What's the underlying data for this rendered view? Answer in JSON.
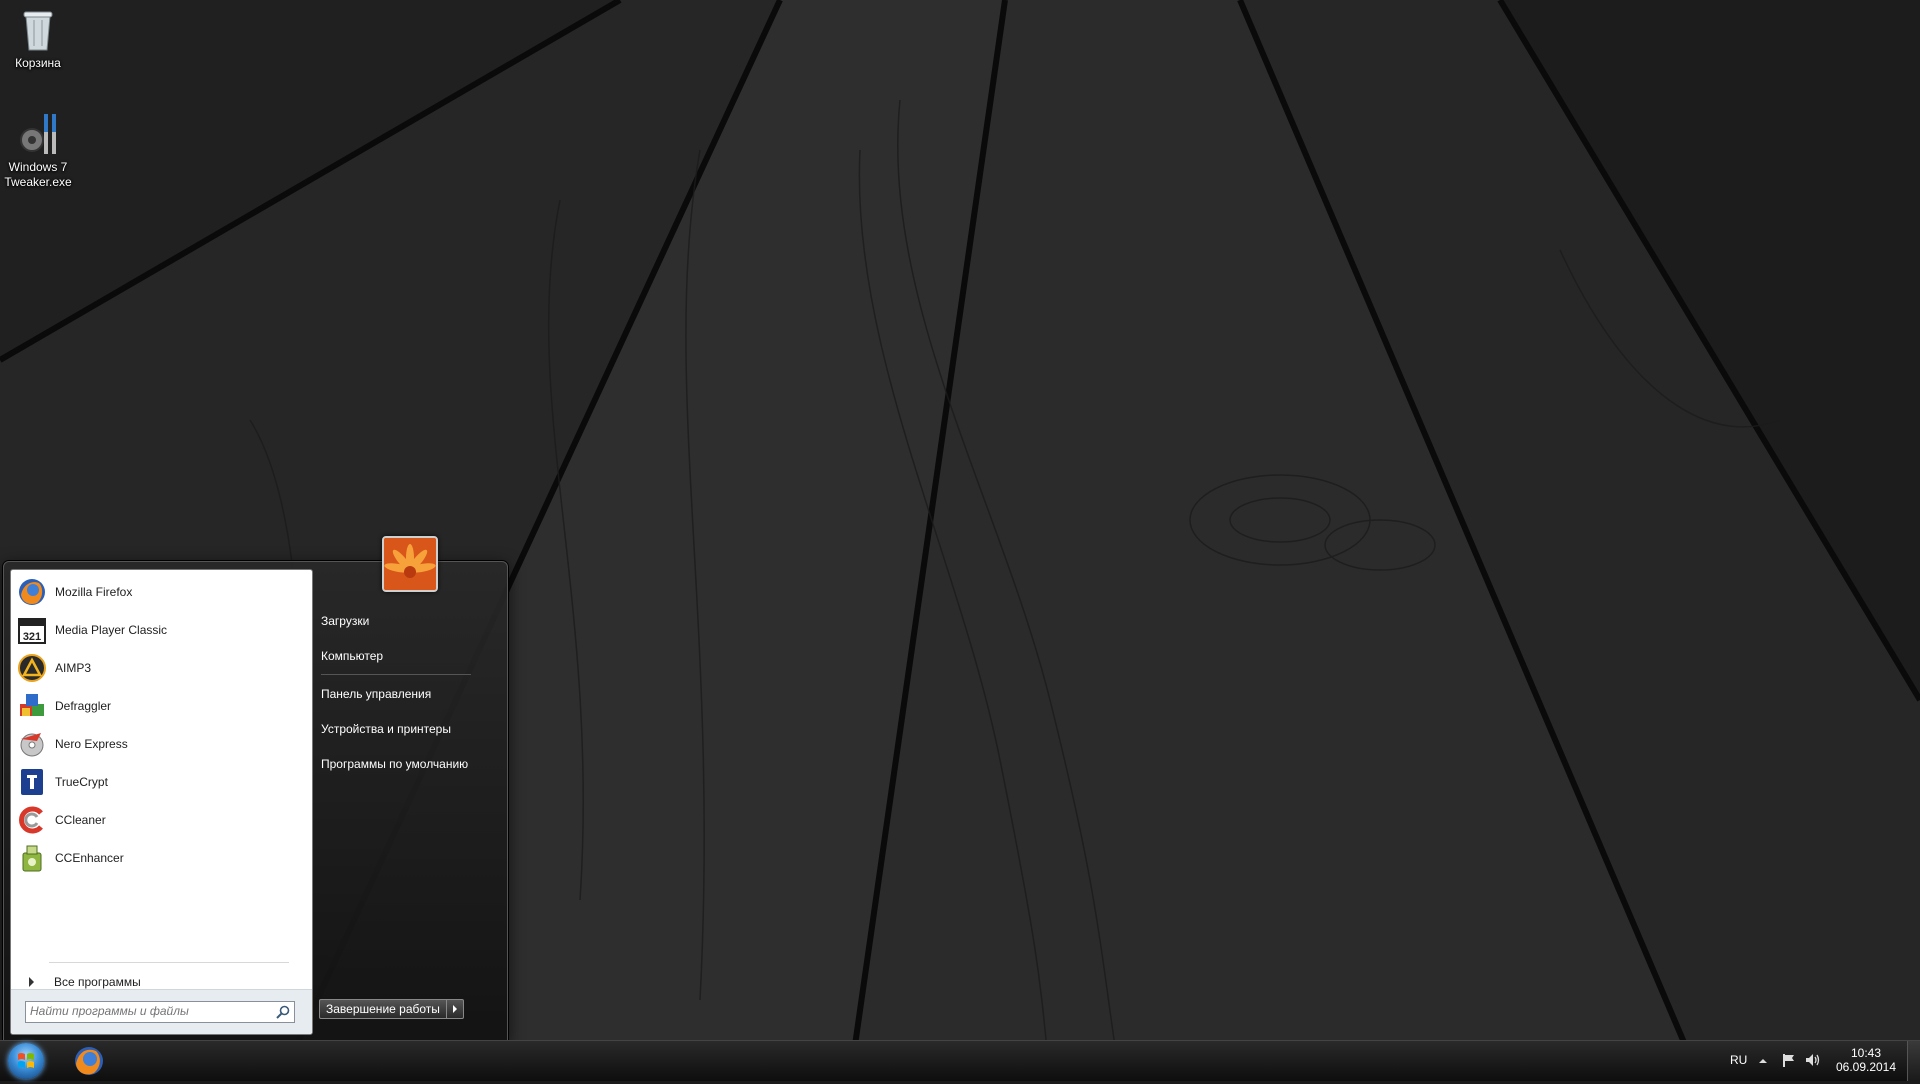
{
  "desktop": {
    "icons": [
      {
        "label": "Корзина",
        "icon": "recycle-bin-icon"
      },
      {
        "label_line1": "Windows 7",
        "label_line2": "Tweaker.exe",
        "icon": "tweaker-tools-icon"
      }
    ]
  },
  "start_menu": {
    "programs": [
      {
        "label": "Mozilla Firefox",
        "icon": "firefox-icon"
      },
      {
        "label": "Media Player Classic",
        "icon": "media-player-classic-icon"
      },
      {
        "label": "AIMP3",
        "icon": "aimp-icon"
      },
      {
        "label": "Defraggler",
        "icon": "defraggler-icon"
      },
      {
        "label": "Nero Express",
        "icon": "nero-icon"
      },
      {
        "label": "TrueCrypt",
        "icon": "truecrypt-icon"
      },
      {
        "label": "CCleaner",
        "icon": "ccleaner-icon"
      },
      {
        "label": "CCEnhancer",
        "icon": "ccenhancer-icon"
      }
    ],
    "all_programs": "Все программы",
    "search_placeholder": "Найти программы и файлы",
    "right_items": [
      "Загрузки",
      "Компьютер",
      "Панель управления",
      "Устройства и принтеры",
      "Программы по умолчанию"
    ],
    "shutdown_label": "Завершение работы"
  },
  "taskbar": {
    "pinned": [
      {
        "icon": "firefox-icon"
      }
    ],
    "language": "RU",
    "time": "10:43",
    "date": "06.09.2014"
  },
  "colors": {
    "accent": "#3b8ed8",
    "menu_bg": "#1f1f1f",
    "user_picture": "#e36a1a"
  }
}
